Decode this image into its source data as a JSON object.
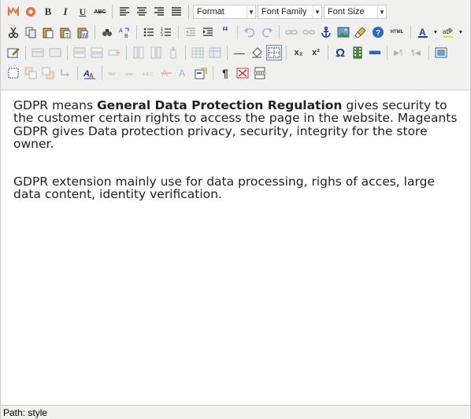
{
  "toolbar": {
    "format_label": "Format",
    "font_family_label": "Font Family",
    "font_size_label": "Font Size",
    "bold_label": "B",
    "italic_label": "I",
    "underline_label": "U",
    "strike_label": "ABC",
    "html_label": "HTML",
    "omega_label": "Ω",
    "subscript_label": "x₂",
    "superscript_label": "x²",
    "hr_label": "—",
    "paragraph_mark_label": "¶",
    "quote_label": "“"
  },
  "content": {
    "para1_prefix": "GDPR means ",
    "para1_bold": "General Data Protection Regulation",
    "para1_suffix": " gives security to the customer certain rights to access the page in the website. Mageants GDPR gives Data protection privacy, security, integrity for the store owner.",
    "para2": "GDPR extension mainly use for data processing, righs of acces, large data content, identity verification."
  },
  "path_label": "Path: style",
  "colors": {
    "toolbar_bg": "#f0f0ee",
    "border": "#cccccc",
    "text_color_accent": "#1a3da8"
  }
}
